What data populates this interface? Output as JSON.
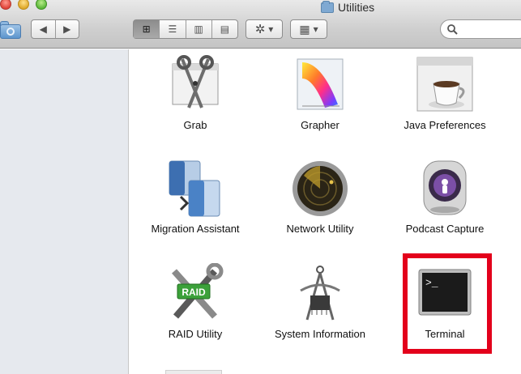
{
  "window": {
    "title": "Utilities"
  },
  "toolbar": {
    "back_glyph": "◀",
    "forward_glyph": "▶",
    "views": [
      "⊞",
      "☰",
      "▥",
      "▤"
    ],
    "action_glyph": "✲",
    "arrange_glyph": "▦",
    "dropdown_glyph": "▾",
    "search": {
      "value": "",
      "placeholder": ""
    }
  },
  "apps": [
    {
      "name": "Grab",
      "icon": "grab-icon"
    },
    {
      "name": "Grapher",
      "icon": "grapher-icon"
    },
    {
      "name": "Java Preferences",
      "icon": "java-preferences-icon"
    },
    {
      "name": "Migration Assistant",
      "icon": "migration-assistant-icon"
    },
    {
      "name": "Network Utility",
      "icon": "network-utility-icon"
    },
    {
      "name": "Podcast Capture",
      "icon": "podcast-capture-icon"
    },
    {
      "name": "RAID Utility",
      "icon": "raid-utility-icon"
    },
    {
      "name": "System Information",
      "icon": "system-information-icon"
    },
    {
      "name": "Terminal",
      "icon": "terminal-icon"
    }
  ],
  "terminal_prompt": ">_",
  "raid_badge": "RAID",
  "colors": {
    "highlight": "#e3001b",
    "sidebar": "#e6e9ee"
  }
}
